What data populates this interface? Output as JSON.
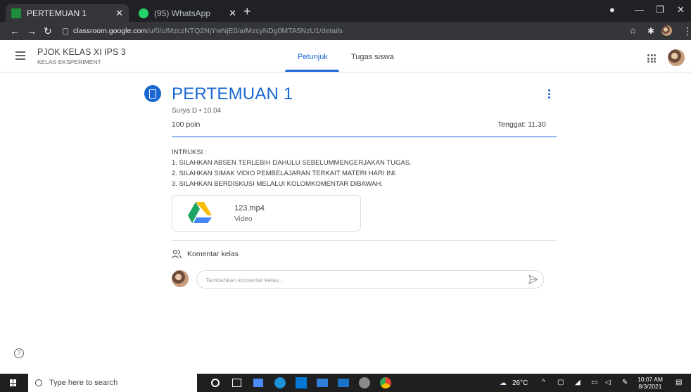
{
  "browser": {
    "tabs": [
      {
        "title": "PERTEMUAN 1",
        "active": true,
        "favicon_color": "#1e8e3e"
      },
      {
        "title": "(95) WhatsApp",
        "active": false,
        "favicon_color": "#25d366"
      }
    ],
    "url_host": "classroom.google.com",
    "url_path": "/u/0/c/MzczNTQ2NjYwNjE0/a/MzcyNDg0MTA5NzU1/details"
  },
  "header": {
    "class_name": "PJOK KELAS XI IPS 3",
    "class_section": "KELAS EKSPERIMENT",
    "tabs": [
      "Petunjuk",
      "Tugas siswa"
    ],
    "accent": "#1967d2"
  },
  "assignment": {
    "title": "PERTEMUAN 1",
    "meta": "Surya D • 10.04",
    "points": "100 poin",
    "due": "Tenggat: 11.30",
    "instructions": [
      "INTRUKSI :",
      "1. SILAHKAN ABSEN TERLEBIH DAHULU SEBELUMMENGERJAKAN TUGAS.",
      "2. SILAHKAN SIMAK VIDIO PEMBELAJARAN TERKAIT MATERI HARI INI.",
      "3. SILAHKAN BERDISKUSI MELALUI KOLOMKOMENTAR DIBAWAH."
    ],
    "attachment": {
      "name": "123.mp4",
      "type": "Video",
      "icon": "google-drive-icon"
    }
  },
  "comments": {
    "label": "Komentar kelas",
    "placeholder": "Tambahkan komentar kelas..."
  },
  "taskbar": {
    "search_placeholder": "Type here to search",
    "weather": "26°C",
    "time": "10:07 AM",
    "date": "8/3/2021"
  }
}
